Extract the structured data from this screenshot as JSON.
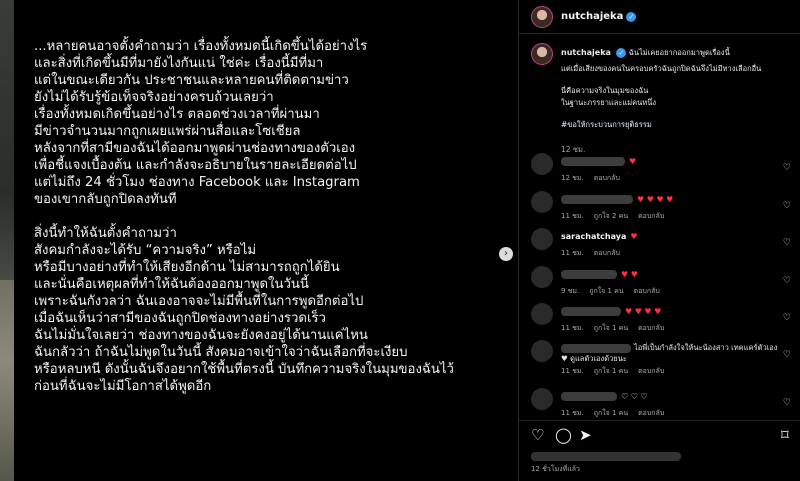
{
  "post": {
    "lines": [
      "...หลายคนอาจตั้งคำถามว่า เรื่องทั้งหมดนี้เกิดขึ้นได้อย่างไร",
      "และสิ่งที่เกิดขึ้นมีที่มายังไงกันแน่ ใช่ค่ะ เรื่องนี้มีที่มา",
      "แต่ในขณะเดียวกัน ประชาชนและหลายคนที่ติดตามข่าว",
      "ยังไม่ได้รับรู้ข้อเท็จจริงอย่างครบถ้วนเลยว่า",
      "เรื่องทั้งหมดเกิดขึ้นอย่างไร ตลอดช่วงเวลาที่ผ่านมา",
      "มีข่าวจำนวนมากถูกเผยแพร่ผ่านสื่อและโซเชียล",
      "หลังจากที่สามีของฉันได้ออกมาพูดผ่านช่องทางของตัวเอง",
      "เพื่อชี้แจงเบื้องต้น และกำลังจะอธิบายในรายละเอียดต่อไป",
      "แต่ไม่ถึง 24 ชั่วโมง ช่องทาง Facebook และ Instagram",
      "ของเขากลับถูกปิดลงทันที",
      "",
      "สิ่งนี้ทำให้ฉันตั้งคำถามว่า",
      "สังคมกำลังจะได้รับ “ความจริง” หรือไม่",
      "หรือมีบางอย่างที่ทำให้เสียงอีกด้าน ไม่สามารถถูกได้ยิน",
      "และนั่นคือเหตุผลที่ทำให้ฉันต้องออกมาพูดในวันนี้",
      "เพราะฉันกังวลว่า ฉันเองอาจจะไม่มีพื้นที่ในการพูดอีกต่อไป",
      "เมื่อฉันเห็นว่าสามีของฉันถูกปิดช่องทางอย่างรวดเร็ว",
      "ฉันไม่มั่นใจเลยว่า ช่องทางของฉันจะยังคงอยู่ได้นานแค่ไหน",
      "ฉันกลัวว่า ถ้าฉันไม่พูดในวันนี้ สังคมอาจเข้าใจว่าฉันเลือกที่จะเงียบ",
      "หรือหลบหนี ดังนั้นฉันจึงอยากใช้พื้นที่ตรงนี้ บันทึกความจริงในมุมของฉันไว้",
      "ก่อนที่ฉันจะไม่มีโอกาสได้พูดอีก"
    ],
    "next_icon": "chevron-right-icon"
  },
  "header": {
    "username": "nutchajeka"
  },
  "caption": {
    "username": "nutchajeka",
    "line1": "ฉันไม่เคยอยากออกมาพูดเรื่องนี้",
    "line2": "แต่เมื่อเสียงของคนในครอบครัวฉันถูกปิดฉันจึงไม่มีทางเลือกอื่น",
    "line3": "นี่คือความจริงในมุมของฉัน",
    "line4": "ในฐานะภรรยาและแม่คนหนึ่ง",
    "hashtag": "#ขอให้กระบวนการยุติธรรม",
    "time": "12 ชม."
  },
  "comments": [
    {
      "user": "",
      "text": "♥",
      "meta_time": "12 ชม.",
      "meta_likes": "",
      "meta_reply": "ตอบกลับ"
    },
    {
      "user": "",
      "text": "♥ ♥ ♥ ♥",
      "meta_time": "11 ชม.",
      "meta_likes": "ถูกใจ 2 คน",
      "meta_reply": "ตอบกลับ"
    },
    {
      "user": "sarachatchaya",
      "text": "♥",
      "meta_time": "11 ชม.",
      "meta_likes": "",
      "meta_reply": "ตอบกลับ"
    },
    {
      "user": "",
      "text": "♥ ♥",
      "meta_time": "9 ชม.",
      "meta_likes": "ถูกใจ 1 คน",
      "meta_reply": "ตอบกลับ"
    },
    {
      "user": "",
      "text": "♥ ♥ ♥ ♥",
      "meta_time": "11 ชม.",
      "meta_likes": "ถูกใจ 1 คน",
      "meta_reply": "ตอบกลับ"
    },
    {
      "user": "",
      "text": "ไอพี่เป็นกำลังใจให้นะน้องสาว เทคแคร์ตัวเอง ♥ ดูแลตัวเองด้วยนะ",
      "meta_time": "11 ชม.",
      "meta_likes": "ถูกใจ 1 คน",
      "meta_reply": "ตอบกลับ"
    },
    {
      "user": "",
      "text": "♡ ♡ ♡",
      "meta_time": "11 ชม.",
      "meta_likes": "ถูกใจ 1 คน",
      "meta_reply": "ตอบกลับ"
    }
  ],
  "actions": {
    "like_icon": "heart-outline-icon",
    "comment_icon": "comment-icon",
    "share_icon": "share-icon",
    "save_icon": "bookmark-icon",
    "time_ago": "12 ชั่วโมงที่แล้ว"
  },
  "colors": {
    "accent_blue": "#3897f0",
    "heart_red": "#ff3040",
    "story_ring": "#c83e8d"
  }
}
